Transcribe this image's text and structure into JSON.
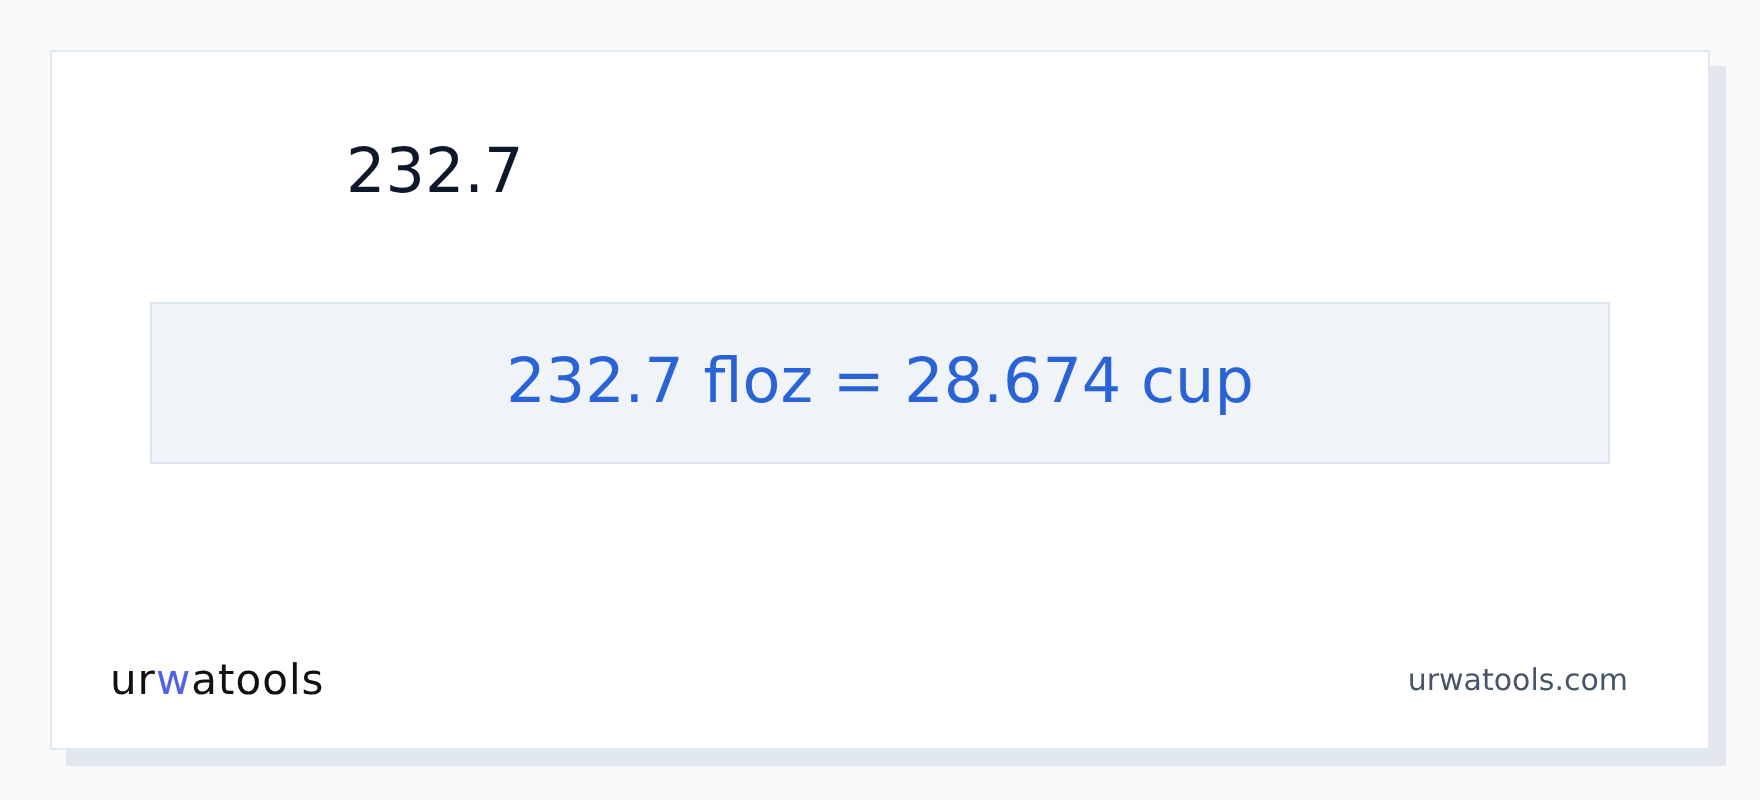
{
  "input_value": "232.7",
  "result": "232.7 floz = 28.674 cup",
  "logo": {
    "parts": [
      {
        "text": "ur",
        "accent": false
      },
      {
        "text": "w",
        "accent": true
      },
      {
        "text": "atools",
        "accent": false
      }
    ]
  },
  "site_url": "urwatools.com"
}
